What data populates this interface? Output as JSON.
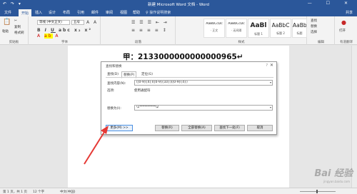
{
  "window": {
    "title": "新建 Microsoft Word 文档 - Word",
    "quick_access": "↶ ↷ ▾",
    "controls": "— ☐ ✕"
  },
  "tabs": [
    {
      "label": "文件"
    },
    {
      "label": "开始"
    },
    {
      "label": "插入"
    },
    {
      "label": "设计"
    },
    {
      "label": "布局"
    },
    {
      "label": "引用"
    },
    {
      "label": "邮件"
    },
    {
      "label": "审阅"
    },
    {
      "label": "视图"
    },
    {
      "label": "帮助"
    }
  ],
  "tell_me": "♀ 操作说明搜索",
  "share": "共享",
  "ribbon": {
    "clipboard": {
      "paste": "粘贴",
      "cut": "✂",
      "copy": "复制",
      "format_painter": "格式刷",
      "label": "剪贴板"
    },
    "font": {
      "name": "等线 (中文正文)",
      "size": "五号",
      "label": "字体"
    },
    "paragraph": {
      "label": "段落"
    },
    "styles": {
      "items": [
        {
          "sample": "AaBbCcDc",
          "name": "· 正文"
        },
        {
          "sample": "AaBbCcDc",
          "name": "· 无间隔"
        },
        {
          "sample": "AaBl",
          "name": "标题 1"
        },
        {
          "sample": "AaBbC",
          "name": "标题 2"
        },
        {
          "sample": "AaBbC",
          "name": "标题"
        }
      ],
      "label": "样式"
    },
    "editing": {
      "find": "查找",
      "replace": "替换",
      "select": "选择",
      "label": "编辑"
    },
    "voice": {
      "label": "打开",
      "sub": "有道翻译"
    }
  },
  "document": {
    "text": "甲：2133000000000000965↵"
  },
  "dialog": {
    "title": "查找和替换",
    "help": "?",
    "close": "✕",
    "tabs": [
      {
        "label": "查找(D)"
      },
      {
        "label": "替换(P)"
      },
      {
        "label": "定位(G)"
      }
    ],
    "find_label": "查找内容(N):",
    "find_value": "([0-9]{4})([0-9]{10})([0-9]{4})",
    "options_label": "选项:",
    "options_value": "使用通配符",
    "replace_label": "替换为(I):",
    "replace_value": "\\1**********\\2",
    "buttons": {
      "more": "更多(M) >>",
      "replace": "替换(R)",
      "replace_all": "全部替换(A)",
      "find_next": "查找下一处(F)",
      "cancel": "取消"
    }
  },
  "status": {
    "page": "第 1 页，共 1 页",
    "words": "12 个字",
    "lang": "中文(中国)"
  },
  "watermark": {
    "main": "Bai 经验",
    "sub": "jingyan.baidu.com"
  },
  "colors": {
    "title_bar": "#2b579a",
    "annotation_arrow": "#e53935"
  }
}
